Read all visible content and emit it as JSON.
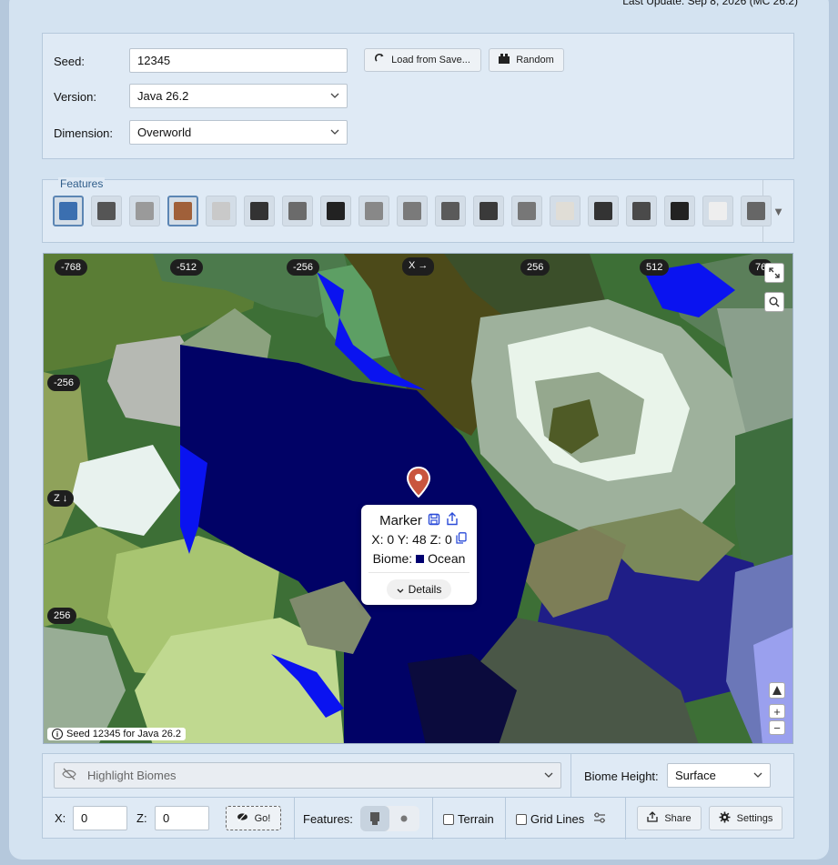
{
  "header": {
    "last_update": "Last Update: Sep 8, 2026 (MC 26.2)"
  },
  "seed_panel": {
    "seed_label": "Seed:",
    "seed_value": "12345",
    "load_button": "Load from Save...",
    "random_button": "Random",
    "version_label": "Version:",
    "version_value": "Java 26.2",
    "dimension_label": "Dimension:",
    "dimension_value": "Overworld"
  },
  "features": {
    "label": "Features",
    "icons": [
      {
        "name": "map-feature-icon",
        "color": "#3b6fb0",
        "selected": true
      },
      {
        "name": "ring-feature-icon",
        "color": "#555555",
        "selected": false
      },
      {
        "name": "stone-feature-icon",
        "color": "#9a9a9a",
        "selected": false
      },
      {
        "name": "villager-feature-icon",
        "color": "#a0603a",
        "selected": true
      },
      {
        "name": "bottle-feature-icon",
        "color": "#c9c9c9",
        "selected": false
      },
      {
        "name": "grid-feature-icon",
        "color": "#333333",
        "selected": false
      },
      {
        "name": "portal-feature-icon",
        "color": "#6b6b6b",
        "selected": false
      },
      {
        "name": "temple-feature-icon",
        "color": "#222222",
        "selected": false
      },
      {
        "name": "igloo-feature-icon",
        "color": "#888888",
        "selected": false
      },
      {
        "name": "monument-feature-icon",
        "color": "#7a7a7a",
        "selected": false
      },
      {
        "name": "rail-feature-icon",
        "color": "#5a5a5a",
        "selected": false
      },
      {
        "name": "vortex-feature-icon",
        "color": "#3a3a3a",
        "selected": false
      },
      {
        "name": "cobble-feature-icon",
        "color": "#777777",
        "selected": false
      },
      {
        "name": "fossil-feature-icon",
        "color": "#e0ddd6",
        "selected": false
      },
      {
        "name": "outpost-feature-icon",
        "color": "#333333",
        "selected": false
      },
      {
        "name": "chest-feature-icon",
        "color": "#4a4a4a",
        "selected": false
      },
      {
        "name": "anchor-icon",
        "color": "#222222",
        "selected": false
      },
      {
        "name": "orb-feature-icon",
        "color": "#eeeeee",
        "selected": false
      },
      {
        "name": "ruin-feature-icon",
        "color": "#666666",
        "selected": false
      }
    ],
    "expand_symbol": "▼"
  },
  "map": {
    "x_ticks": [
      "-768",
      "-512",
      "-256",
      "256",
      "512",
      "76"
    ],
    "x_axis_label": "X →",
    "y_ticks": [
      "-256",
      "256"
    ],
    "z_axis_label": "Z ↓",
    "caption": "Seed 12345 for Java 26.2",
    "zoom_in": "+",
    "zoom_out": "−",
    "popup": {
      "title": "Marker",
      "coords": "X: 0 Y: 48 Z: 0",
      "biome_label": "Biome:",
      "biome_value": "Ocean",
      "biome_color": "#000070",
      "details": "Details"
    }
  },
  "bottom": {
    "highlight_placeholder": "Highlight Biomes",
    "biome_height_label": "Biome Height:",
    "biome_height_value": "Surface",
    "x_label": "X:",
    "x_value": "0",
    "z_label": "Z:",
    "z_value": "0",
    "go_button": "Go!",
    "features_label": "Features:",
    "terrain_label": "Terrain",
    "gridlines_label": "Grid Lines",
    "share_button": "Share",
    "settings_button": "Settings"
  }
}
